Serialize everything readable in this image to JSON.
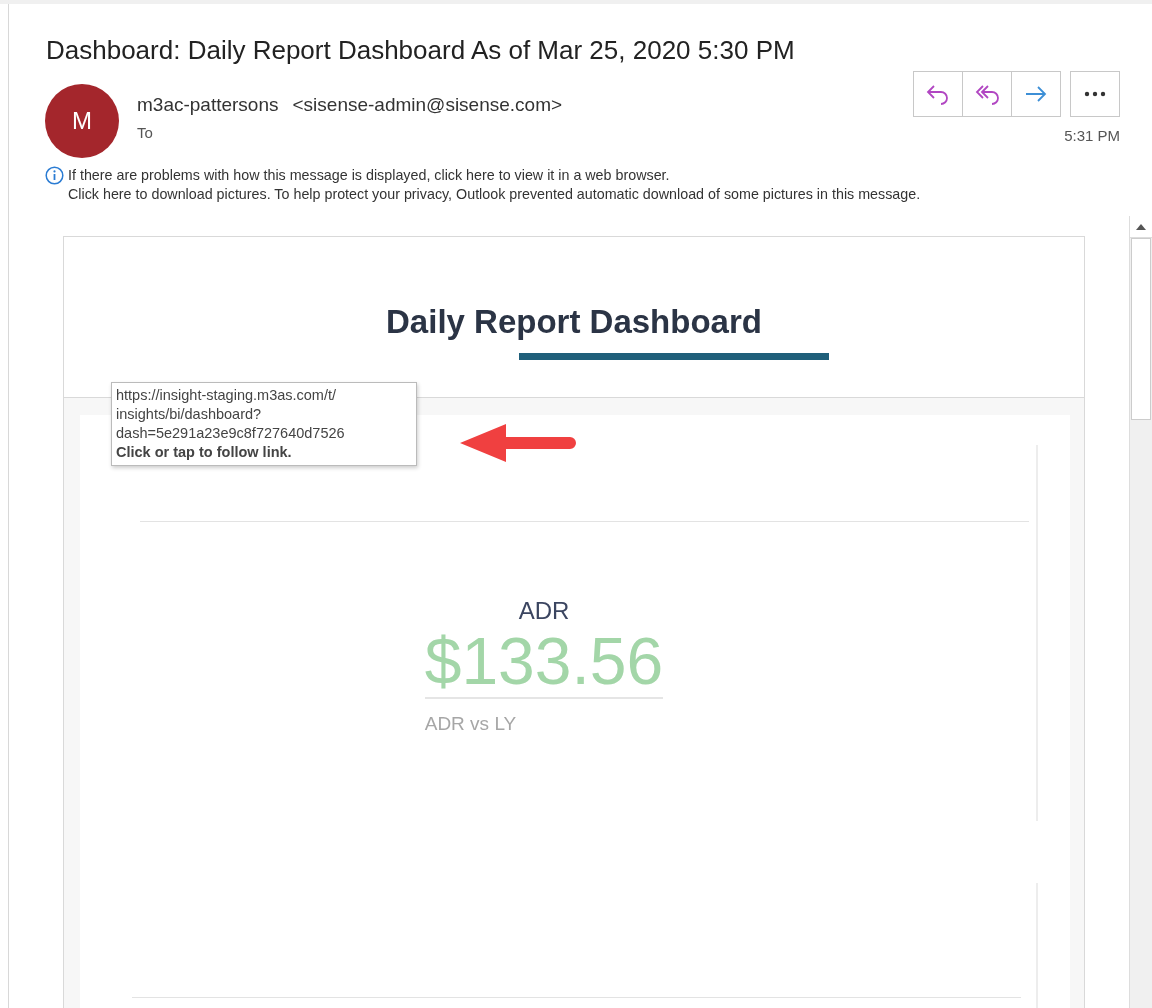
{
  "message": {
    "subject": "Dashboard: Daily Report Dashboard As of Mar 25, 2020 5:30 PM",
    "sender": {
      "initial": "M",
      "name": "m3ac-pattersons",
      "email": "<sisense-admin@sisense.com>"
    },
    "to_label": "To",
    "time": "5:31 PM",
    "actions": [
      {
        "kind": "reply"
      },
      {
        "kind": "reply_all"
      },
      {
        "kind": "forward"
      },
      {
        "kind": "more"
      }
    ],
    "info": [
      "If there are problems with how this message is displayed, click here to view it in a web browser.",
      "Click here to download pictures. To help protect your privacy, Outlook prevented automatic download of some pictures in this message."
    ]
  },
  "dashboard": {
    "title": "Daily Report Dashboard",
    "widgets": [
      {
        "title": "ADR",
        "value": "$133.56",
        "subtitle": "ADR vs LY"
      }
    ]
  },
  "link_tooltip": {
    "url_lines": [
      "https://insight-staging.m3as.com/t/",
      "insights/bi/dashboard?",
      "dash=5e291a23e9c8f727640d7526"
    ],
    "hint": "Click or tap to follow link."
  }
}
